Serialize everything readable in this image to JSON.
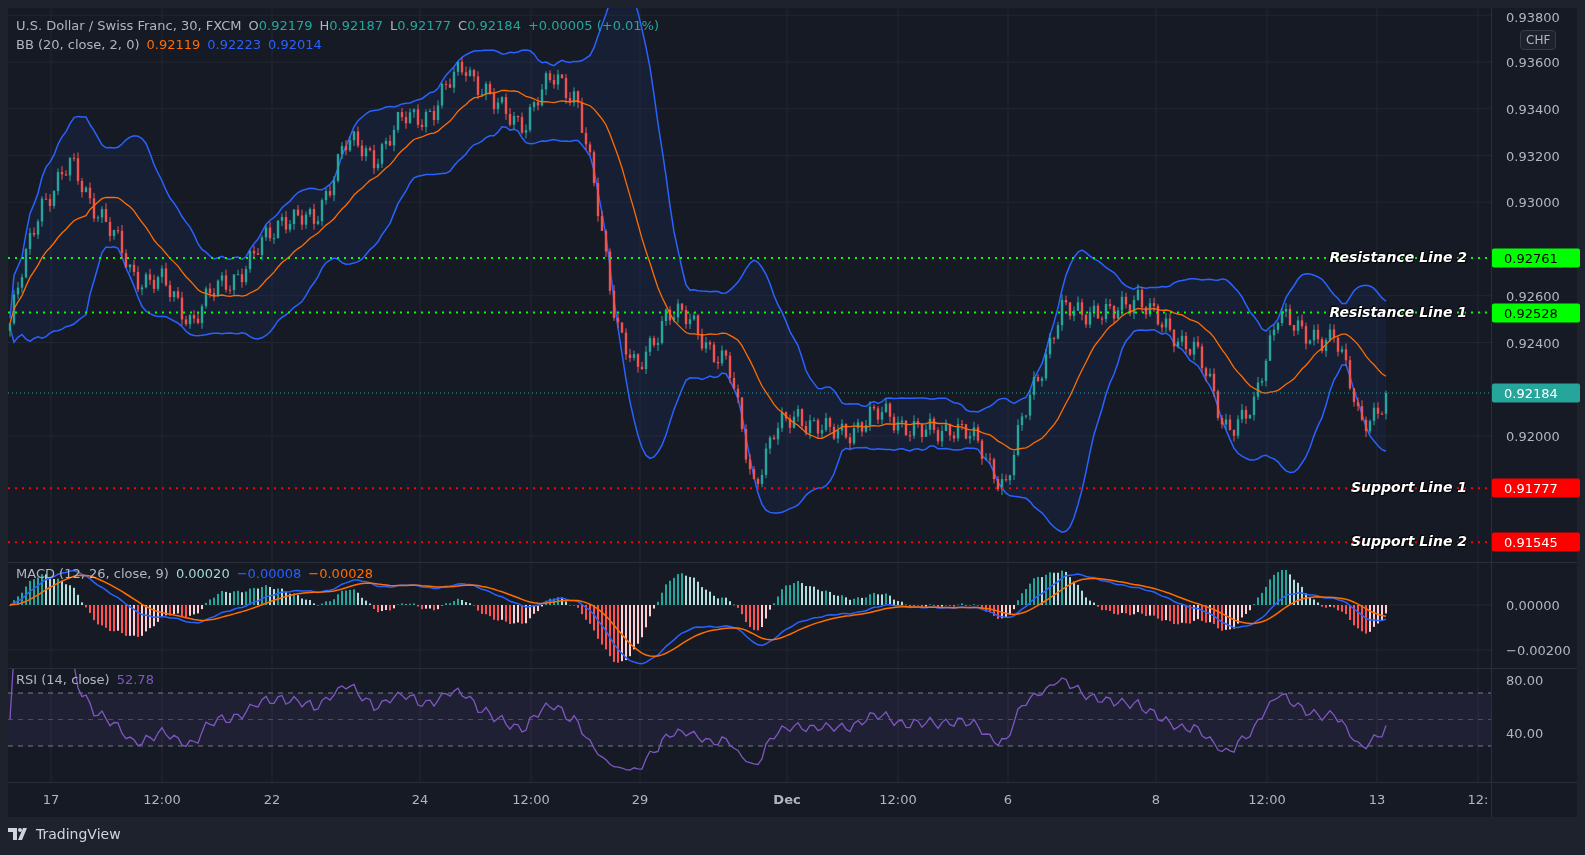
{
  "legend": {
    "symbol": "U.S. Dollar / Swiss Franc, 30, FXCM",
    "ohlc": [
      {
        "key": "O",
        "value": "0.92179"
      },
      {
        "key": "H",
        "value": "0.92187"
      },
      {
        "key": "L",
        "value": "0.92177"
      },
      {
        "key": "C",
        "value": "0.92184"
      }
    ],
    "change": "+0.00005 (+0.01%)"
  },
  "bb": {
    "label": "BB (20, close, 2, 0)",
    "values": [
      {
        "value": "0.92119",
        "color": "#ff6d00"
      },
      {
        "value": "0.92223",
        "color": "#2962ff"
      },
      {
        "value": "0.92014",
        "color": "#2962ff"
      }
    ]
  },
  "price_axis": {
    "currency": "CHF",
    "ticks": [
      "0.93800",
      "0.93600",
      "0.93400",
      "0.93200",
      "0.93000",
      "0.92600",
      "0.92400",
      "0.92000"
    ]
  },
  "levels": [
    {
      "label": "Resistance Line 2",
      "price": "0.92761",
      "color": "#00ff00"
    },
    {
      "label": "Resistance Line 1",
      "price": "0.92528",
      "color": "#00ff00"
    },
    {
      "label": "Support Line 1",
      "price": "0.91777",
      "color": "#ff0000"
    },
    {
      "label": "Support Line 2",
      "price": "0.91545",
      "color": "#ff0000"
    }
  ],
  "last_price": "0.92184",
  "macd": {
    "label": "MACD (12, 26, close, 9)",
    "values": [
      {
        "value": "0.00020",
        "color": "#a3d9d0"
      },
      {
        "value": "−0.00008",
        "color": "#2962ff"
      },
      {
        "value": "−0.00028",
        "color": "#ff6d00"
      }
    ],
    "ticks": [
      "0.00000",
      "−0.00200"
    ]
  },
  "rsi": {
    "label": "RSI (14, close)",
    "value": "52.78",
    "ticks": [
      "80.00",
      "40.00"
    ]
  },
  "time_axis": [
    {
      "label": "17",
      "bold": false
    },
    {
      "label": "12:00",
      "bold": false
    },
    {
      "label": "22",
      "bold": false
    },
    {
      "label": "24",
      "bold": false
    },
    {
      "label": "12:00",
      "bold": false
    },
    {
      "label": "29",
      "bold": false
    },
    {
      "label": "Dec",
      "bold": true
    },
    {
      "label": "12:00",
      "bold": false
    },
    {
      "label": "6",
      "bold": false
    },
    {
      "label": "8",
      "bold": false
    },
    {
      "label": "12:00",
      "bold": false
    },
    {
      "label": "13",
      "bold": false
    },
    {
      "label": "12:",
      "bold": false
    }
  ],
  "brand": "TradingView"
}
